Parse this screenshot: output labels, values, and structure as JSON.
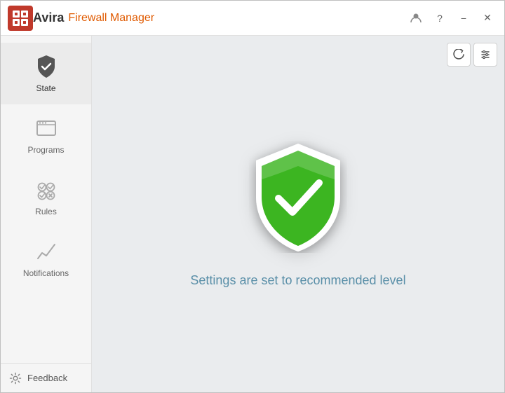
{
  "titlebar": {
    "app_name": "Avira",
    "subtitle": "Firewall Manager",
    "logo_alt": "Avira logo"
  },
  "window_controls": {
    "user_label": "👤",
    "help_label": "?",
    "minimize_label": "−",
    "close_label": "✕"
  },
  "sidebar": {
    "items": [
      {
        "id": "state",
        "label": "State",
        "active": true
      },
      {
        "id": "programs",
        "label": "Programs",
        "active": false
      },
      {
        "id": "rules",
        "label": "Rules",
        "active": false
      },
      {
        "id": "notifications",
        "label": "Notifications",
        "active": false
      }
    ],
    "feedback_label": "Feedback",
    "gear_label": "⚙"
  },
  "toolbar": {
    "refresh_label": "↺",
    "settings_label": "⊞"
  },
  "content": {
    "status_text": "Settings are set to recommended level"
  }
}
